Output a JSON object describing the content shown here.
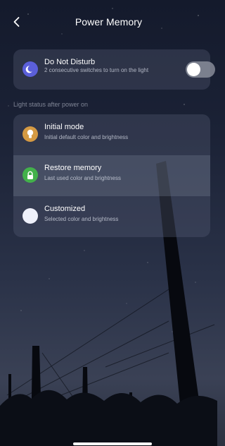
{
  "header": {
    "title": "Power Memory",
    "back_icon": "chevron-left-icon"
  },
  "do_not_disturb": {
    "title": "Do Not Disturb",
    "subtitle": "2 consecutive switches to turn on the light",
    "icon": "moon-icon",
    "icon_color": "#5b5fd9",
    "toggle_on": false
  },
  "section_label": "Light status after power on",
  "modes": [
    {
      "title": "Initial mode",
      "subtitle": "Initial default color and brightness",
      "icon": "bulb-icon",
      "icon_color": "#d59a43",
      "selected": false
    },
    {
      "title": "Restore memory",
      "subtitle": "Last used color and brightness",
      "icon": "lock-icon",
      "icon_color": "#43b14b",
      "selected": true
    },
    {
      "title": "Customized",
      "subtitle": "Selected color and brightness",
      "icon": "circle-icon",
      "icon_color": "#eef0fa",
      "selected": false
    }
  ]
}
